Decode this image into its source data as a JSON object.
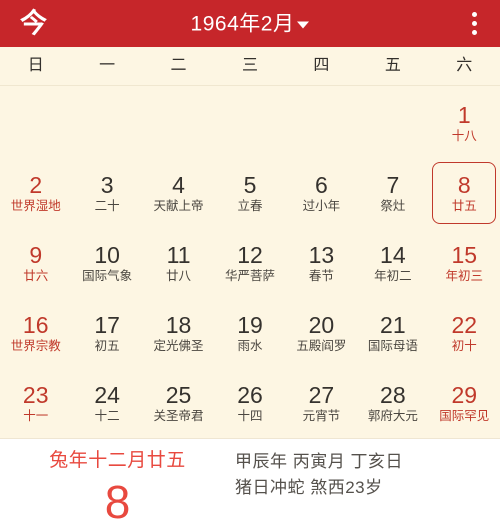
{
  "topbar": {
    "today_label": "今",
    "title": "1964年2月",
    "caret_icon": "chevron-down-icon",
    "overflow_icon": "more-vertical-icon",
    "background_color": "#c6262a"
  },
  "weekdays": [
    "日",
    "一",
    "二",
    "三",
    "四",
    "五",
    "六"
  ],
  "calendar": {
    "accent_color": "#c0392b",
    "background_color": "#fdf6e3",
    "selected_day": 8,
    "weeks": [
      [
        {
          "num": "",
          "sub": "",
          "empty": true
        },
        {
          "num": "",
          "sub": "",
          "empty": true
        },
        {
          "num": "",
          "sub": "",
          "empty": true
        },
        {
          "num": "",
          "sub": "",
          "empty": true
        },
        {
          "num": "",
          "sub": "",
          "empty": true
        },
        {
          "num": "",
          "sub": "",
          "empty": true
        },
        {
          "num": "1",
          "sub": "十八",
          "weekend": true
        }
      ],
      [
        {
          "num": "2",
          "sub": "世界湿地",
          "weekend": true
        },
        {
          "num": "3",
          "sub": "二十"
        },
        {
          "num": "4",
          "sub": "天献上帝"
        },
        {
          "num": "5",
          "sub": "立春"
        },
        {
          "num": "6",
          "sub": "过小年"
        },
        {
          "num": "7",
          "sub": "祭灶"
        },
        {
          "num": "8",
          "sub": "廿五",
          "weekend": true,
          "selected": true
        }
      ],
      [
        {
          "num": "9",
          "sub": "廿六",
          "weekend": true
        },
        {
          "num": "10",
          "sub": "国际气象"
        },
        {
          "num": "11",
          "sub": "廿八"
        },
        {
          "num": "12",
          "sub": "华严菩萨"
        },
        {
          "num": "13",
          "sub": "春节"
        },
        {
          "num": "14",
          "sub": "年初二"
        },
        {
          "num": "15",
          "sub": "年初三",
          "weekend": true
        }
      ],
      [
        {
          "num": "16",
          "sub": "世界宗教",
          "weekend": true
        },
        {
          "num": "17",
          "sub": "初五"
        },
        {
          "num": "18",
          "sub": "定光佛圣"
        },
        {
          "num": "19",
          "sub": "雨水"
        },
        {
          "num": "20",
          "sub": "五殿阎罗"
        },
        {
          "num": "21",
          "sub": "国际母语"
        },
        {
          "num": "22",
          "sub": "初十",
          "weekend": true
        }
      ],
      [
        {
          "num": "23",
          "sub": "十一",
          "weekend": true
        },
        {
          "num": "24",
          "sub": "十二"
        },
        {
          "num": "25",
          "sub": "关圣帝君"
        },
        {
          "num": "26",
          "sub": "十四"
        },
        {
          "num": "27",
          "sub": "元宵节"
        },
        {
          "num": "28",
          "sub": "郭府大元"
        },
        {
          "num": "29",
          "sub": "国际罕见",
          "weekend": true
        }
      ]
    ]
  },
  "detail": {
    "lunar_date": "兔年十二月廿五",
    "day_number": "8",
    "ganzhi_line1": "甲辰年 丙寅月 丁亥日",
    "ganzhi_line2": "猪日冲蛇 煞西23岁"
  }
}
